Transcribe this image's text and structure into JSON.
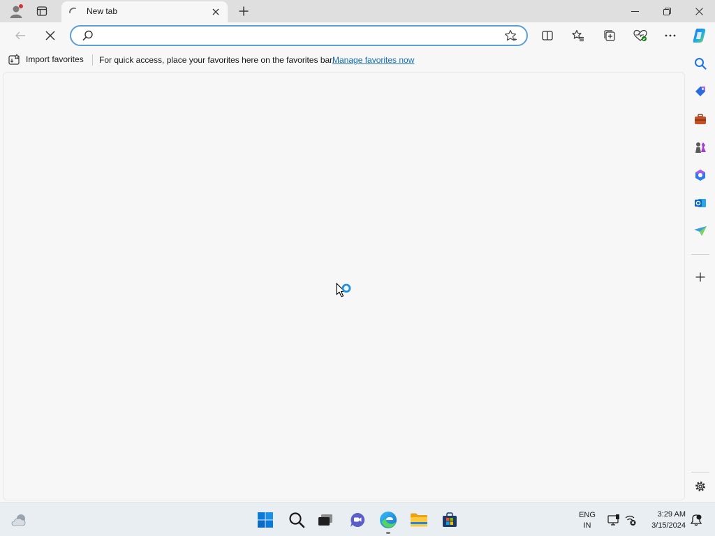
{
  "tab": {
    "title": "New tab"
  },
  "address_bar": {
    "value": "",
    "placeholder": ""
  },
  "favorites_bar": {
    "import_label": "Import favorites",
    "message": "For quick access, place your favorites here on the favorites bar.",
    "link": "Manage favorites now"
  },
  "system_tray": {
    "lang_line1": "ENG",
    "lang_line2": "IN",
    "time": "3:29 AM",
    "date": "3/15/2024"
  },
  "colors": {
    "accent": "#0067c0",
    "address_border": "#5a9fd6",
    "link": "#1a6fb5",
    "titlebar": "#dfdfdf",
    "page_background": "#f7f7f7",
    "taskbar": "#e9eef3"
  },
  "icons": {
    "titlebar": [
      "profile-icon",
      "workspaces-icon"
    ],
    "toolbar": [
      "back-icon",
      "stop-icon",
      "search-icon",
      "star-add-icon",
      "split-screen-icon",
      "favorites-icon",
      "collections-icon",
      "browser-essentials-icon",
      "more-icon",
      "copilot-icon"
    ],
    "sidebar": [
      "sidebar-search-icon",
      "shopping-icon",
      "tools-icon",
      "games-icon",
      "microsoft-365-icon",
      "outlook-icon",
      "drop-icon",
      "add-icon",
      "settings-icon"
    ],
    "taskbar": [
      "weather-icon",
      "start-icon",
      "taskbar-search-icon",
      "task-view-icon",
      "chat-icon",
      "edge-icon",
      "file-explorer-icon",
      "store-icon",
      "display-icon",
      "network-icon",
      "notifications-icon"
    ]
  }
}
